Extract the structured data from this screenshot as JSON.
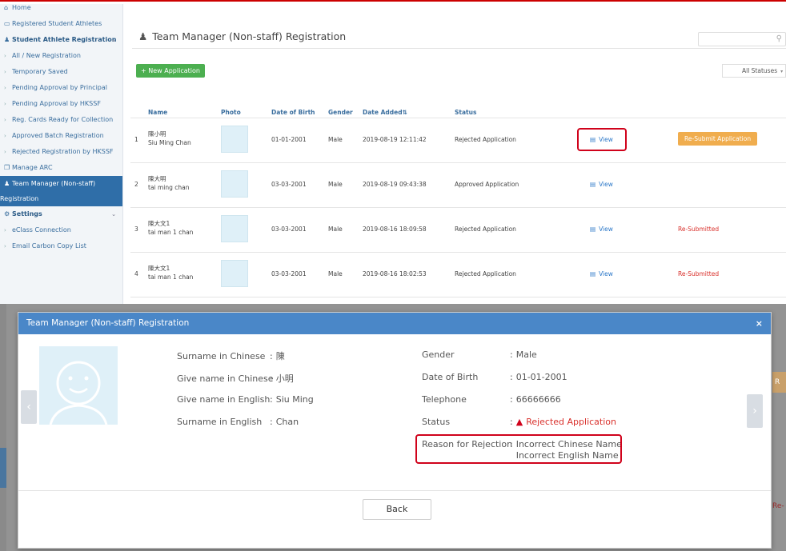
{
  "sidebar": {
    "items": [
      {
        "label": "Home",
        "icon": "home-icon",
        "type": "top"
      },
      {
        "label": "Registered Student Athletes",
        "icon": "card-icon",
        "type": "top"
      },
      {
        "label": "Student Athlete Registration",
        "icon": "user-icon",
        "type": "section"
      },
      {
        "label": "All / New Registration",
        "type": "sub"
      },
      {
        "label": "Temporary Saved",
        "type": "sub"
      },
      {
        "label": "Pending Approval by Principal",
        "type": "sub"
      },
      {
        "label": "Pending Approval by HKSSF",
        "type": "sub"
      },
      {
        "label": "Reg. Cards Ready for Collection",
        "type": "sub"
      },
      {
        "label": "Approved Batch Registration",
        "type": "sub"
      },
      {
        "label": "Rejected Registration by HKSSF",
        "type": "sub"
      },
      {
        "label": "Manage ARC",
        "icon": "copy-icon",
        "type": "top"
      },
      {
        "label": "Team Manager (Non-staff)",
        "label2": "Registration",
        "icon": "user-icon",
        "type": "active"
      },
      {
        "label": "Settings",
        "icon": "gear-icon",
        "type": "section"
      },
      {
        "label": "eClass Connection",
        "type": "sub"
      },
      {
        "label": "Email Carbon Copy List",
        "type": "sub"
      }
    ]
  },
  "page": {
    "title": "Team Manager (Non-staff) Registration",
    "new_button": "+ New Application",
    "status_filter": "All Statuses"
  },
  "table": {
    "headers": [
      "Name",
      "Photo",
      "Date of Birth",
      "Gender",
      "Date Added⇅",
      "Status"
    ],
    "rows": [
      {
        "idx": "1",
        "name_cn": "陳小明",
        "name_en": "Siu Ming Chan",
        "dob": "01-01-2001",
        "gender": "Male",
        "added": "2019-08-19 12:11:42",
        "status": "Rejected Application",
        "view": "View",
        "action": "Re-Submit Application"
      },
      {
        "idx": "2",
        "name_cn": "陳大明",
        "name_en": "tai ming chan",
        "dob": "03-03-2001",
        "gender": "Male",
        "added": "2019-08-19 09:43:38",
        "status": "Approved Application",
        "view": "View",
        "action": ""
      },
      {
        "idx": "3",
        "name_cn": "陳大文1",
        "name_en": "tai man 1 chan",
        "dob": "03-03-2001",
        "gender": "Male",
        "added": "2019-08-16 18:09:58",
        "status": "Rejected Application",
        "view": "View",
        "action": "Re-Submitted"
      },
      {
        "idx": "4",
        "name_cn": "陳大文1",
        "name_en": "tai man 1 chan",
        "dob": "03-03-2001",
        "gender": "Male",
        "added": "2019-08-16 18:02:53",
        "status": "Rejected Application",
        "view": "View",
        "action": "Re-Submitted"
      }
    ]
  },
  "background_peek": {
    "right_button_text": "R",
    "right_text": "Re-"
  },
  "modal": {
    "title": "Team Manager (Non-staff) Registration",
    "close": "×",
    "left": [
      {
        "label": "Surname in Chinese",
        "value": "陳"
      },
      {
        "label": "Give name in Chinese",
        "value": "小明"
      },
      {
        "label": "Give name in English",
        "value": "Siu Ming"
      },
      {
        "label": "Surname in English",
        "value": "Chan"
      }
    ],
    "right": [
      {
        "label": "Gender",
        "value": "Male"
      },
      {
        "label": "Date of Birth",
        "value": "01-01-2001"
      },
      {
        "label": "Telephone",
        "value": "66666666"
      },
      {
        "label": "Status",
        "value": "Rejected Application"
      }
    ],
    "rejection_label": "Reason for Rejection",
    "rejection_reasons": [
      "Incorrect Chinese Name",
      "Incorrect English Name"
    ],
    "back": "Back",
    "prev": "‹",
    "next": "›"
  },
  "colors": {
    "accent": "#4a87c8",
    "sidebar_active": "#2f6ea8",
    "green": "#4caf50",
    "orange": "#f0ad4e",
    "red": "#d9302b"
  }
}
